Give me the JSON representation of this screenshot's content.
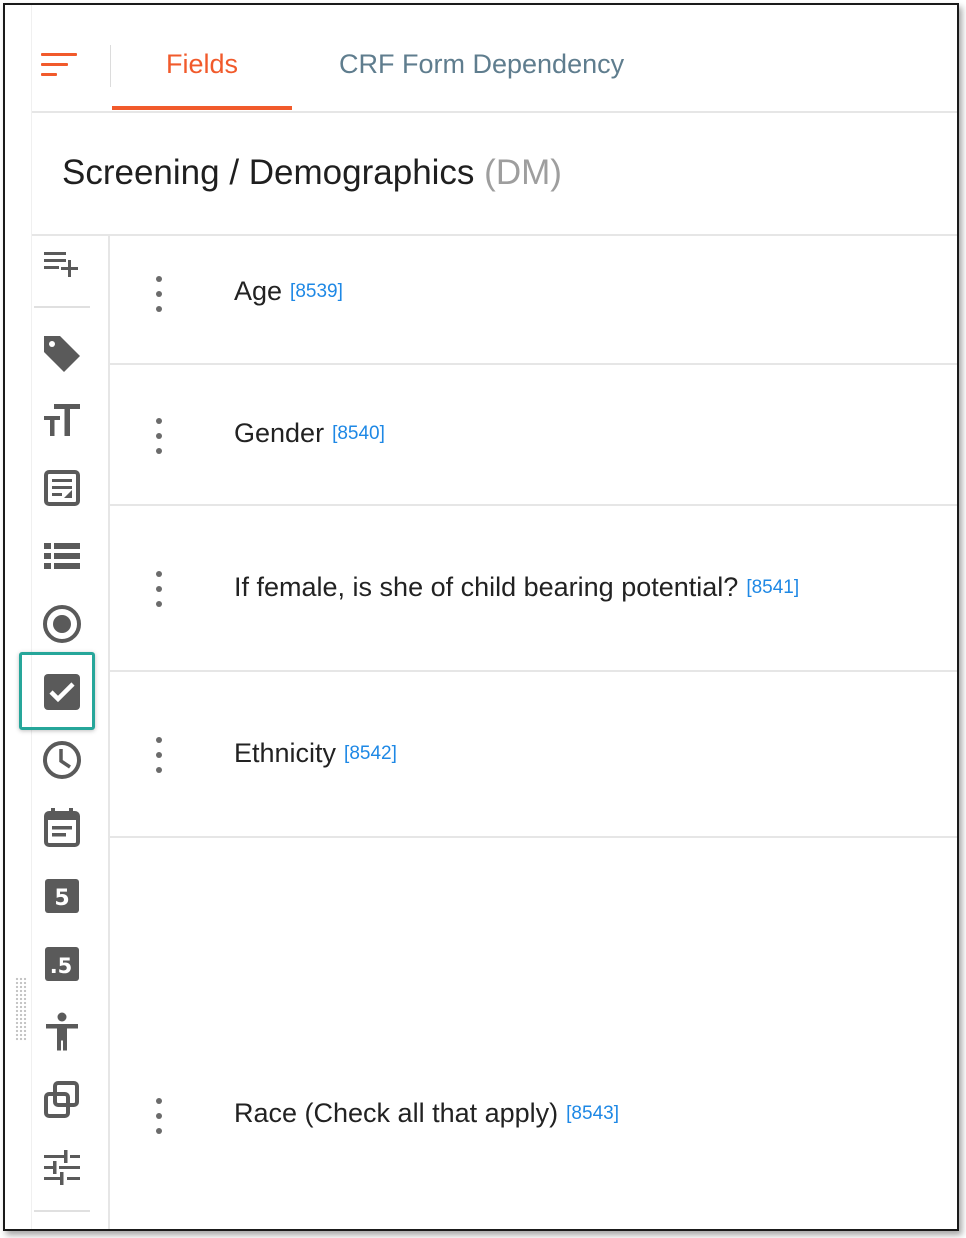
{
  "tabs": [
    {
      "label": "Fields",
      "active": true
    },
    {
      "label": "CRF Form Dependency",
      "active": false
    }
  ],
  "form": {
    "name": "Screening / Demographics",
    "code": "(DM)"
  },
  "toolbox": {
    "icons": [
      "add-field-icon",
      "tag-icon",
      "text-size-icon",
      "text-area-icon",
      "list-icon",
      "radio-icon",
      "checkbox-icon",
      "time-icon",
      "date-icon",
      "integer-icon",
      "decimal-icon",
      "accessibility-icon",
      "copy-icon",
      "tune-icon"
    ],
    "selected": "checkbox-icon",
    "integer_glyph": "5",
    "decimal_glyph": ".5"
  },
  "fields": [
    {
      "label": "Age",
      "id": "[8539]"
    },
    {
      "label": "Gender",
      "id": "[8540]"
    },
    {
      "label": "If female, is she of child bearing potential?",
      "id": "[8541]"
    },
    {
      "label": "Ethnicity",
      "id": "[8542]"
    },
    {
      "label": "Race (Check all that apply)",
      "id": "[8543]"
    }
  ],
  "colors": {
    "accent": "#f15a2b",
    "tab_inactive": "#5f7d8e",
    "id_link": "#1e88e5",
    "icon": "#5a5a5a",
    "selection": "#26a69a"
  }
}
